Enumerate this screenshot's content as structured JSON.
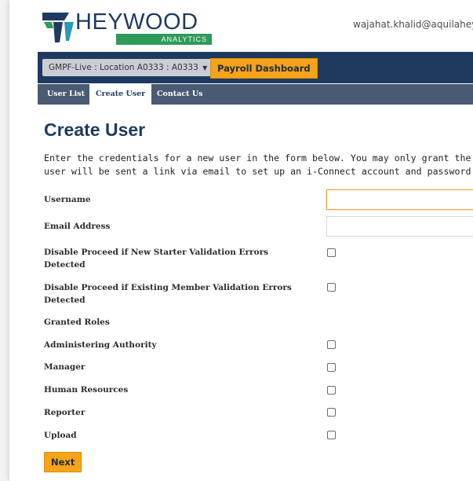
{
  "header": {
    "logo_text": "HEYWOOD",
    "logo_sub": "ANALYTICS",
    "user_email": "wajahat.khalid@aquilaheyw"
  },
  "topbar": {
    "location_select": "GMPF-Live : Location A0333 : A0333",
    "payroll_button": "Payroll Dashboard"
  },
  "tabs": [
    {
      "label": "User List",
      "active": false
    },
    {
      "label": "Create User",
      "active": true
    },
    {
      "label": "Contact Us",
      "active": false
    }
  ],
  "page": {
    "title": "Create User",
    "intro_line1": "Enter the credentials for a new user in the form below. You may only grant the new us",
    "intro_line2": "user will be sent a link via email to set up an i-Connect account and password."
  },
  "form": {
    "username_label": "Username",
    "username_value": "",
    "email_label": "Email Address",
    "email_value": "",
    "disable_new_starter_label": "Disable Proceed if New Starter Validation Errors Detected",
    "disable_existing_member_label": "Disable Proceed if Existing Member Validation Errors Detected",
    "granted_roles_label": "Granted Roles",
    "roles": [
      {
        "label": "Administering Authority",
        "checked": false
      },
      {
        "label": "Manager",
        "checked": false
      },
      {
        "label": "Human Resources",
        "checked": false
      },
      {
        "label": "Reporter",
        "checked": false
      },
      {
        "label": "Upload",
        "checked": false
      }
    ],
    "next_button": "Next"
  },
  "colors": {
    "navy": "#1f3a5f",
    "tabbar": "#4a5a72",
    "accent_orange": "#f5a31a",
    "logo_green": "#2e9a5a",
    "logo_teal": "#2a9ab5"
  }
}
